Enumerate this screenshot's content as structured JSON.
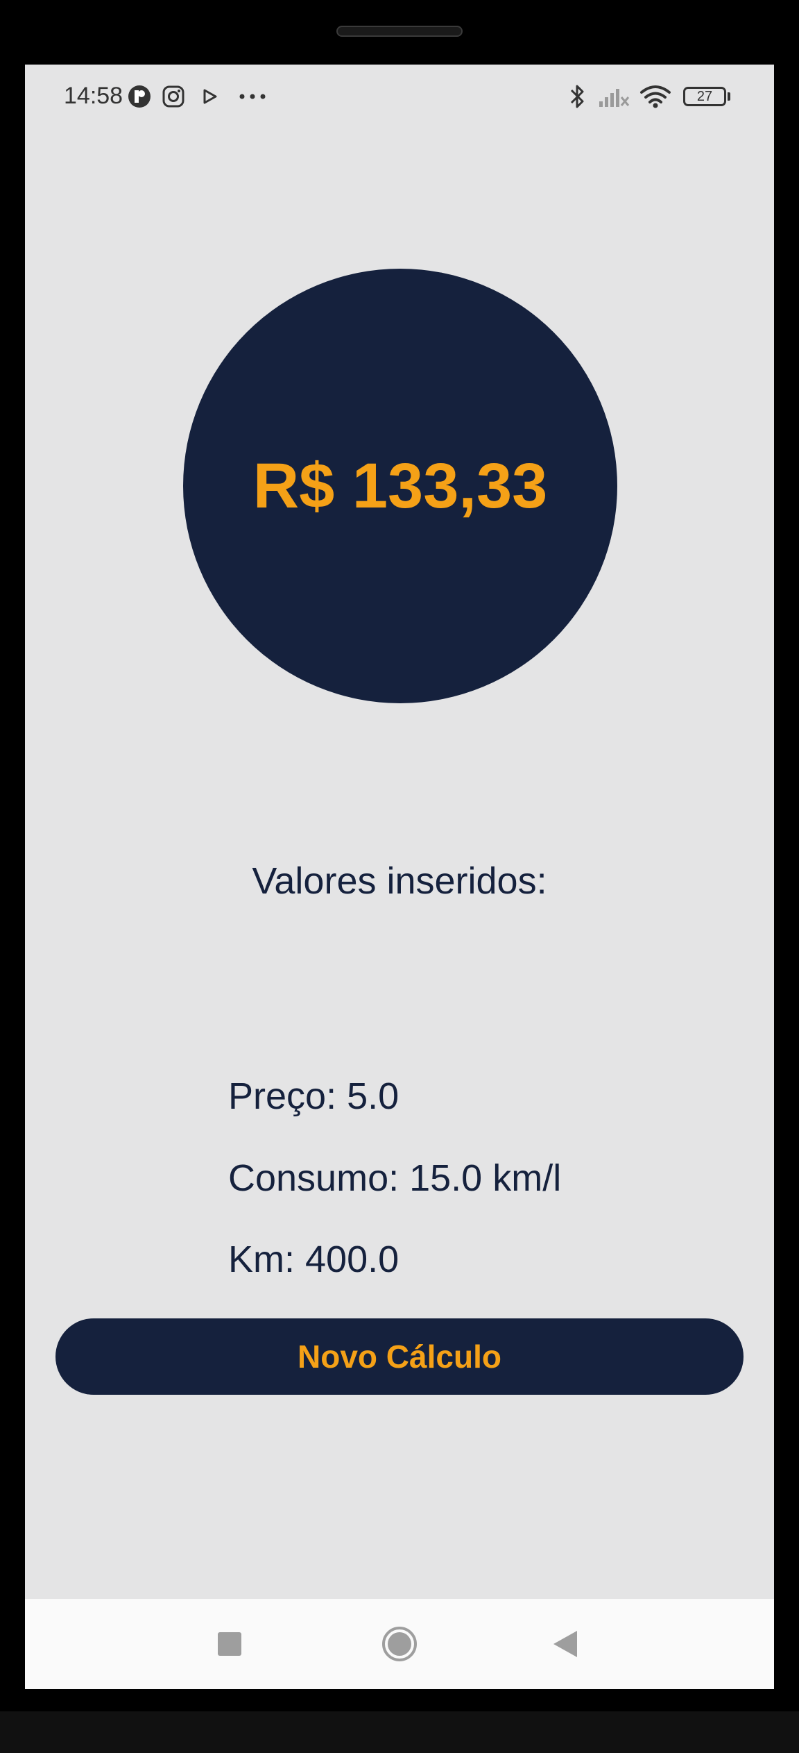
{
  "status_bar": {
    "time": "14:58",
    "battery": "27",
    "icons": [
      "app-icon",
      "instagram-icon",
      "play-icon",
      "more-dots-icon",
      "bluetooth-icon",
      "signal-icon",
      "wifi-icon",
      "battery-icon"
    ]
  },
  "result": {
    "value": "R$ 133,33"
  },
  "inputs": {
    "title": "Valores inseridos:",
    "price": "Preço: 5.0",
    "consumption": "Consumo: 15.0 km/l",
    "km": "Km: 400.0"
  },
  "actions": {
    "new_calc_label": "Novo Cálculo"
  },
  "colors": {
    "background": "#e4e4e5",
    "primary": "#15213d",
    "accent": "#f5a117"
  }
}
